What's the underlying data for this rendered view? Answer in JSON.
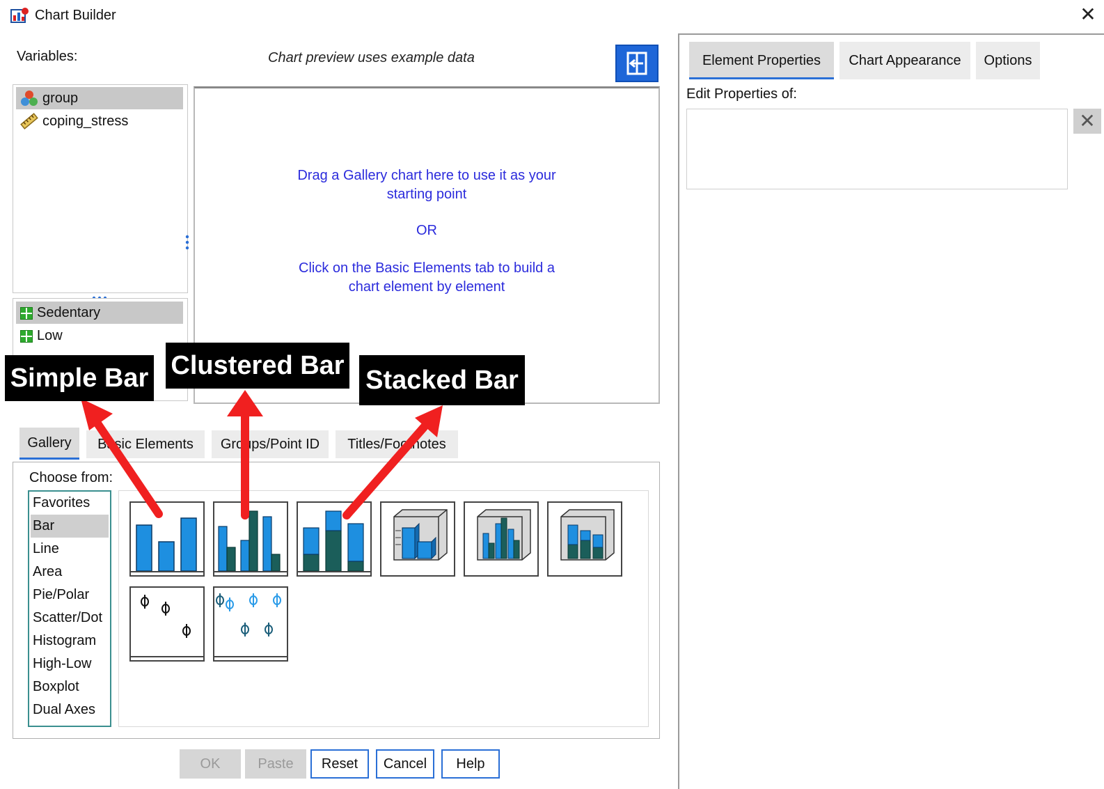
{
  "window": {
    "title": "Chart Builder",
    "close_glyph": "✕"
  },
  "left": {
    "variables_label": "Variables:",
    "preview_note": "Chart preview uses example data",
    "variables": [
      {
        "name": "group",
        "icon": "nominal-variable-icon",
        "selected": true
      },
      {
        "name": "coping_stress",
        "icon": "scale-variable-icon",
        "selected": false
      }
    ],
    "categories": [
      {
        "name": "Sedentary",
        "selected": true
      },
      {
        "name": "Low",
        "selected": false
      }
    ],
    "canvas": {
      "line1": "Drag a Gallery chart here to use it as your",
      "line2": "starting point",
      "or": "OR",
      "line3": "Click on the Basic Elements tab to build a",
      "line4": "chart element by element"
    }
  },
  "gallery_tabs": [
    "Gallery",
    "Basic Elements",
    "Groups/Point ID",
    "Titles/Footnotes"
  ],
  "gallery": {
    "choose_label": "Choose from:",
    "types": [
      "Favorites",
      "Bar",
      "Line",
      "Area",
      "Pie/Polar",
      "Scatter/Dot",
      "Histogram",
      "High-Low",
      "Boxplot",
      "Dual Axes"
    ],
    "selected_type": "Bar"
  },
  "buttons": {
    "ok": "OK",
    "paste": "Paste",
    "reset": "Reset",
    "cancel": "Cancel",
    "help": "Help"
  },
  "right": {
    "tabs": [
      "Element Properties",
      "Chart Appearance",
      "Options"
    ],
    "edit_label": "Edit Properties of:",
    "delete_glyph": "✕"
  },
  "annotations": {
    "simple_bar": "Simple Bar",
    "clustered_bar": "Clustered Bar",
    "stacked_bar": "Stacked Bar",
    "arrow_color": "#f02020"
  },
  "colors": {
    "accent": "#2a6fd6",
    "canvas_text": "#2b2bdc",
    "bar_blue": "#1e8fe0",
    "bar_teal": "#1b5e5a"
  }
}
